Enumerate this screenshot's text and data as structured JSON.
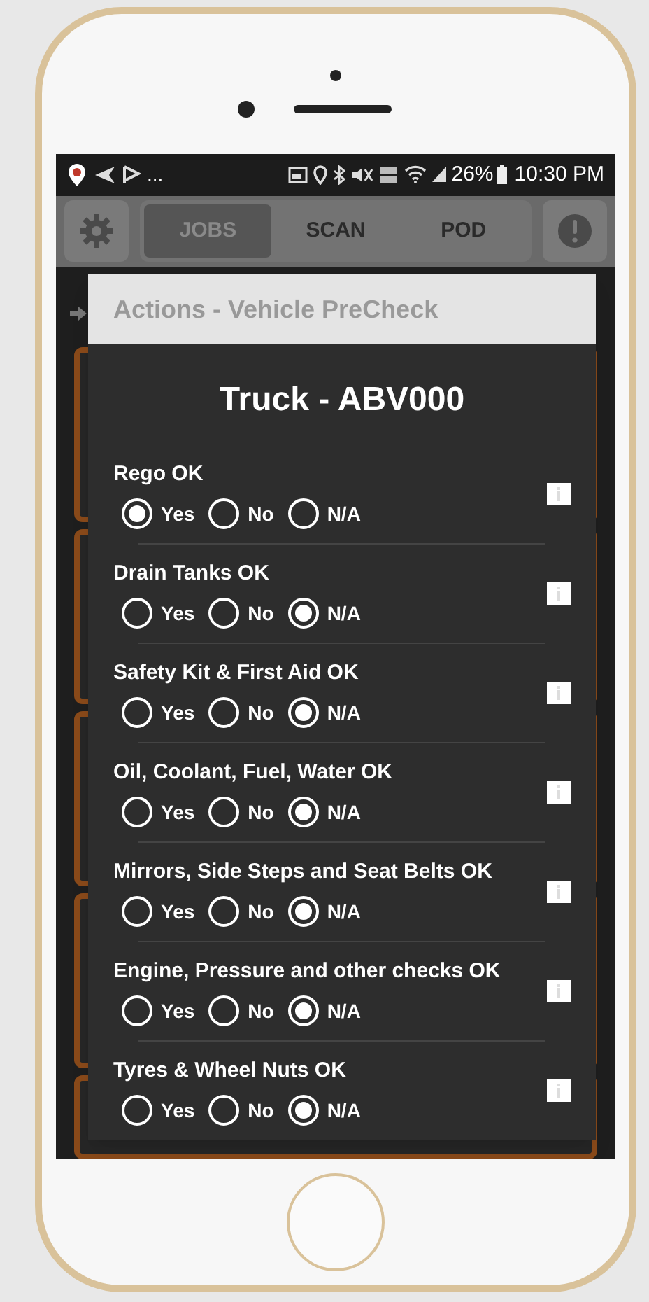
{
  "status_bar": {
    "overflow": "...",
    "battery": "26%",
    "time": "10:30 PM"
  },
  "nav": {
    "tabs": [
      {
        "label": "JOBS",
        "selected": true
      },
      {
        "label": "SCAN",
        "selected": false
      },
      {
        "label": "POD",
        "selected": false
      }
    ]
  },
  "dialog": {
    "header": "Actions - Vehicle PreCheck",
    "title": "Truck - ABV000",
    "items": [
      {
        "label": "Rego OK",
        "options": [
          {
            "label": "Yes",
            "selected": true
          },
          {
            "label": "No",
            "selected": false
          },
          {
            "label": "N/A",
            "selected": false
          }
        ]
      },
      {
        "label": "Drain Tanks OK",
        "options": [
          {
            "label": "Yes",
            "selected": false
          },
          {
            "label": "No",
            "selected": false
          },
          {
            "label": "N/A",
            "selected": true
          }
        ]
      },
      {
        "label": "Safety Kit & First Aid OK",
        "options": [
          {
            "label": "Yes",
            "selected": false
          },
          {
            "label": "No",
            "selected": false
          },
          {
            "label": "N/A",
            "selected": true
          }
        ]
      },
      {
        "label": "Oil, Coolant, Fuel, Water OK",
        "options": [
          {
            "label": "Yes",
            "selected": false
          },
          {
            "label": "No",
            "selected": false
          },
          {
            "label": "N/A",
            "selected": true
          }
        ]
      },
      {
        "label": "Mirrors, Side Steps and Seat Belts OK",
        "options": [
          {
            "label": "Yes",
            "selected": false
          },
          {
            "label": "No",
            "selected": false
          },
          {
            "label": "N/A",
            "selected": true
          }
        ]
      },
      {
        "label": "Engine, Pressure and other checks OK",
        "options": [
          {
            "label": "Yes",
            "selected": false
          },
          {
            "label": "No",
            "selected": false
          },
          {
            "label": "N/A",
            "selected": true
          }
        ]
      },
      {
        "label": "Tyres & Wheel Nuts OK",
        "options": [
          {
            "label": "Yes",
            "selected": false
          },
          {
            "label": "No",
            "selected": false
          },
          {
            "label": "N/A",
            "selected": true
          }
        ]
      }
    ]
  }
}
